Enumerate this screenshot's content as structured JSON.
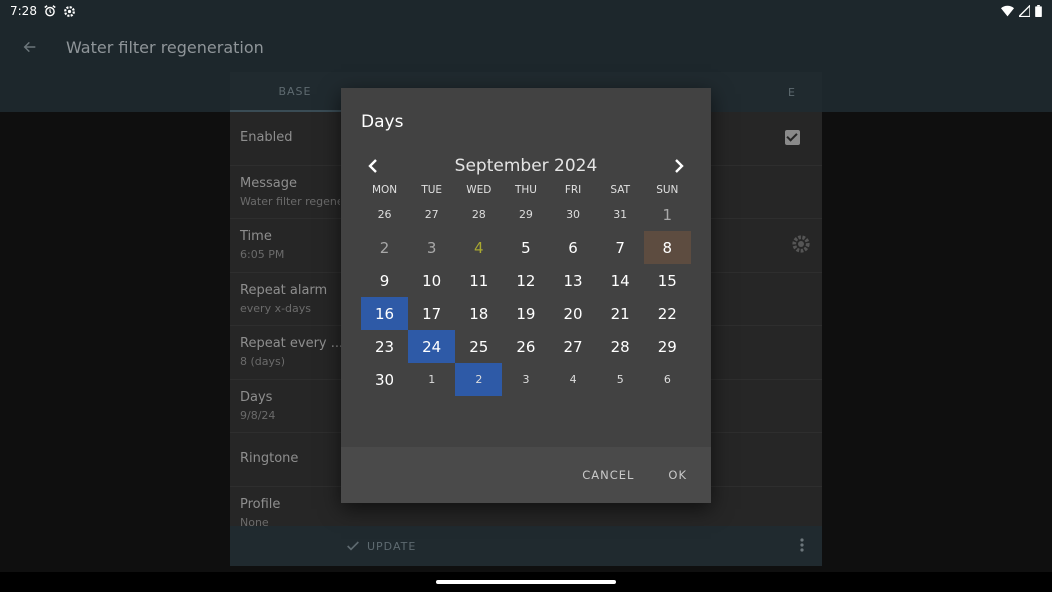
{
  "status_bar": {
    "time": "7:28"
  },
  "app_bar": {
    "title": "Water filter regeneration"
  },
  "tabs": [
    "BASE",
    "E"
  ],
  "settings": [
    {
      "label": "Enabled",
      "sub": ""
    },
    {
      "label": "Message",
      "sub": "Water filter regenera"
    },
    {
      "label": "Time",
      "sub": "6:05 PM"
    },
    {
      "label": "Repeat alarm",
      "sub": "every x-days"
    },
    {
      "label": "Repeat every ...",
      "sub": "8 (days)"
    },
    {
      "label": "Days",
      "sub": "9/8/24"
    },
    {
      "label": "Ringtone",
      "sub": ""
    },
    {
      "label": "Profile",
      "sub": "None"
    }
  ],
  "bottom_bar": {
    "update_label": "UPDATE"
  },
  "dialog": {
    "title": "Days",
    "month_label": "September 2024",
    "weekdays": [
      "MON",
      "TUE",
      "WED",
      "THU",
      "FRI",
      "SAT",
      "SUN"
    ],
    "weeks": [
      [
        {
          "d": "26",
          "cls": "small"
        },
        {
          "d": "27",
          "cls": "small"
        },
        {
          "d": "28",
          "cls": "small"
        },
        {
          "d": "29",
          "cls": "small"
        },
        {
          "d": "30",
          "cls": "small"
        },
        {
          "d": "31",
          "cls": "small"
        },
        {
          "d": "1",
          "cls": "muted"
        }
      ],
      [
        {
          "d": "2",
          "cls": "muted"
        },
        {
          "d": "3",
          "cls": "muted"
        },
        {
          "d": "4",
          "cls": "today"
        },
        {
          "d": "5",
          "cls": ""
        },
        {
          "d": "6",
          "cls": ""
        },
        {
          "d": "7",
          "cls": ""
        },
        {
          "d": "8",
          "cls": "current"
        }
      ],
      [
        {
          "d": "9",
          "cls": ""
        },
        {
          "d": "10",
          "cls": ""
        },
        {
          "d": "11",
          "cls": ""
        },
        {
          "d": "12",
          "cls": ""
        },
        {
          "d": "13",
          "cls": ""
        },
        {
          "d": "14",
          "cls": ""
        },
        {
          "d": "15",
          "cls": ""
        }
      ],
      [
        {
          "d": "16",
          "cls": "sel"
        },
        {
          "d": "17",
          "cls": ""
        },
        {
          "d": "18",
          "cls": ""
        },
        {
          "d": "19",
          "cls": ""
        },
        {
          "d": "20",
          "cls": ""
        },
        {
          "d": "21",
          "cls": ""
        },
        {
          "d": "22",
          "cls": ""
        }
      ],
      [
        {
          "d": "23",
          "cls": ""
        },
        {
          "d": "24",
          "cls": "sel"
        },
        {
          "d": "25",
          "cls": ""
        },
        {
          "d": "26",
          "cls": ""
        },
        {
          "d": "27",
          "cls": ""
        },
        {
          "d": "28",
          "cls": ""
        },
        {
          "d": "29",
          "cls": ""
        }
      ],
      [
        {
          "d": "30",
          "cls": ""
        },
        {
          "d": "1",
          "cls": "small"
        },
        {
          "d": "2",
          "cls": "small sel"
        },
        {
          "d": "3",
          "cls": "small"
        },
        {
          "d": "4",
          "cls": "small"
        },
        {
          "d": "5",
          "cls": "small"
        },
        {
          "d": "6",
          "cls": "small"
        }
      ]
    ],
    "cancel_label": "CANCEL",
    "ok_label": "OK"
  },
  "colors": {
    "selected_day": "#2e5aa7",
    "current_value_day": "#5d4c40",
    "today_text": "#a9a830",
    "dialog_bg": "#424242"
  }
}
